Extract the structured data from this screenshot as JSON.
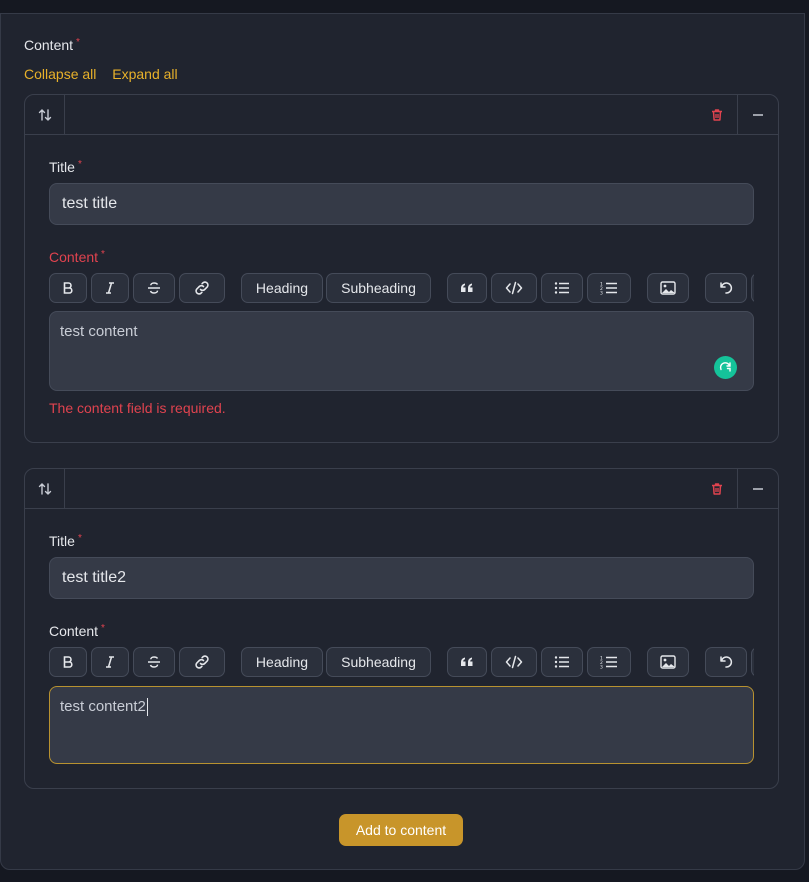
{
  "form": {
    "content_label": "Content",
    "required_mark": "*",
    "collapse_all": "Collapse all",
    "expand_all": "Expand all",
    "add_button": "Add to content"
  },
  "toolbar": {
    "heading": "Heading",
    "subheading": "Subheading",
    "icons": [
      "bold-icon",
      "italic-icon",
      "strikethrough-icon",
      "link-icon",
      "quote-icon",
      "code-icon",
      "bullet-list-icon",
      "ordered-list-icon",
      "image-icon",
      "undo-icon"
    ]
  },
  "items": [
    {
      "title_label": "Title",
      "title_value": "test title",
      "content_label": "Content",
      "content_value": "test content",
      "error": "The content field is required."
    },
    {
      "title_label": "Title",
      "title_value": "test title2",
      "content_label": "Content",
      "content_value": "test content2"
    }
  ],
  "colors": {
    "accent": "#e8b12a",
    "button": "#c8952a",
    "error": "#e0434f",
    "panel": "#20242f",
    "input": "#353a47"
  }
}
